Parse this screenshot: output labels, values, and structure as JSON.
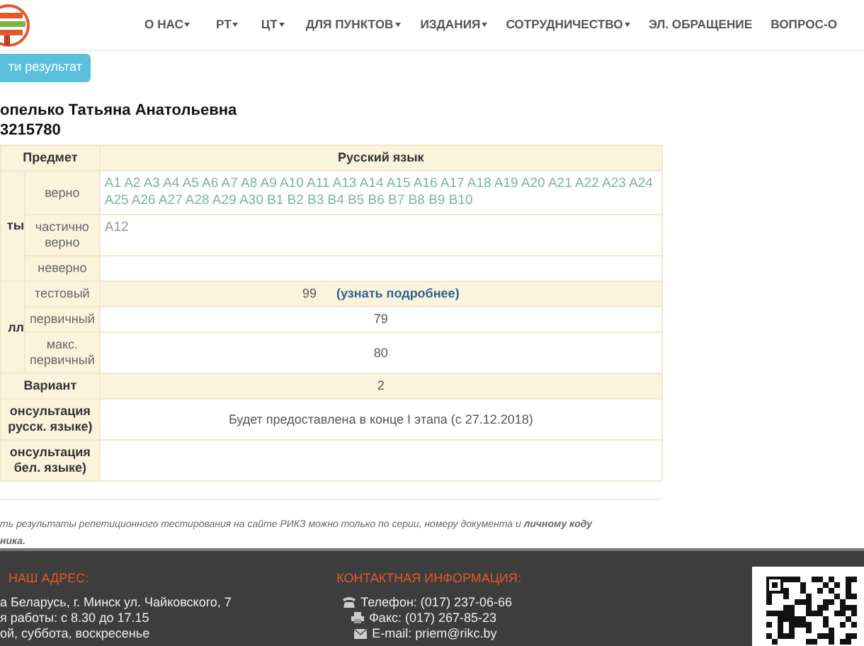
{
  "nav": {
    "items": [
      {
        "label": "О НАС",
        "dropdown": true
      },
      {
        "label": "РТ",
        "dropdown": true
      },
      {
        "label": "ЦТ",
        "dropdown": true
      },
      {
        "label": "ДЛЯ ПУНКТОВ",
        "dropdown": true
      },
      {
        "label": "ИЗДАНИЯ",
        "dropdown": true
      },
      {
        "label": "СОТРУДНИЧЕСТВО",
        "dropdown": true
      },
      {
        "label": "ЭЛ. ОБРАЩЕНИЕ",
        "dropdown": false
      },
      {
        "label": "ВОПРОС-О",
        "dropdown": false
      }
    ]
  },
  "result_button": "ти результат",
  "person": {
    "name": "опелько Татьяна Анатольевна",
    "code": "3215780"
  },
  "table": {
    "header": {
      "label": "Предмет",
      "subject": "Русский язык"
    },
    "sections": [
      {
        "kind": "group",
        "label": "ты",
        "rows": [
          {
            "label": "верно",
            "value": "A1 A2 A3 A4 A5 A6 A7 A8 A9 A10 A11 A13 A14 A15 A16 A17 A18 A19 A20 A21 A22 A23 A24 A25 A26 A27 A28 A29 A30 B1 B2 B3 B4 B5 B6 B7 B8 B9 B10",
            "kind": "correct",
            "shaded": false
          },
          {
            "label": "частично верно",
            "value": "A12",
            "kind": "partial",
            "shaded": false
          },
          {
            "label": "неверно",
            "kind": "wrong",
            "shaded": false
          }
        ]
      },
      {
        "kind": "group",
        "label": "лл",
        "rows": [
          {
            "label": "тестовый",
            "value": "99",
            "link": "(узнать подробнее)",
            "kind": "number",
            "shaded": true
          },
          {
            "label": "первичный",
            "value": "79",
            "kind": "number",
            "shaded": false
          },
          {
            "label": "макс. первичный",
            "value": "80",
            "kind": "number",
            "shaded": false
          }
        ]
      },
      {
        "kind": "single",
        "label": "Вариант",
        "value": "2",
        "shaded": true
      },
      {
        "kind": "single",
        "label": "онсультация русск. языке)",
        "value": "Будет предоставлена в конце I этапа (с 27.12.2018)",
        "shaded": false
      },
      {
        "kind": "single",
        "label": "онсультация бел. языке)",
        "shaded": false
      }
    ]
  },
  "note": "ть результаты репетиционного тестирования на сайте РИКЗ можно только по серии, номеру документа и **личному коду ника.**",
  "footer": {
    "address": {
      "title": "НАШ АДРЕС:",
      "lines": [
        "а Беларусь, г. Минск ул. Чайковского, 7",
        "я работы: с 8.30 до 17.15",
        "ой, суббота, воскресенье"
      ]
    },
    "contacts": {
      "title": "КОНТАКТНАЯ ИНФОРМАЦИЯ:",
      "items": [
        {
          "kind": "phone",
          "text": "Телефон: (017) 237-06-66"
        },
        {
          "kind": "fax",
          "text": "Факс: (017) 267-85-23"
        },
        {
          "kind": "mail",
          "text": "E-mail: priem@rikc.by"
        }
      ]
    }
  }
}
